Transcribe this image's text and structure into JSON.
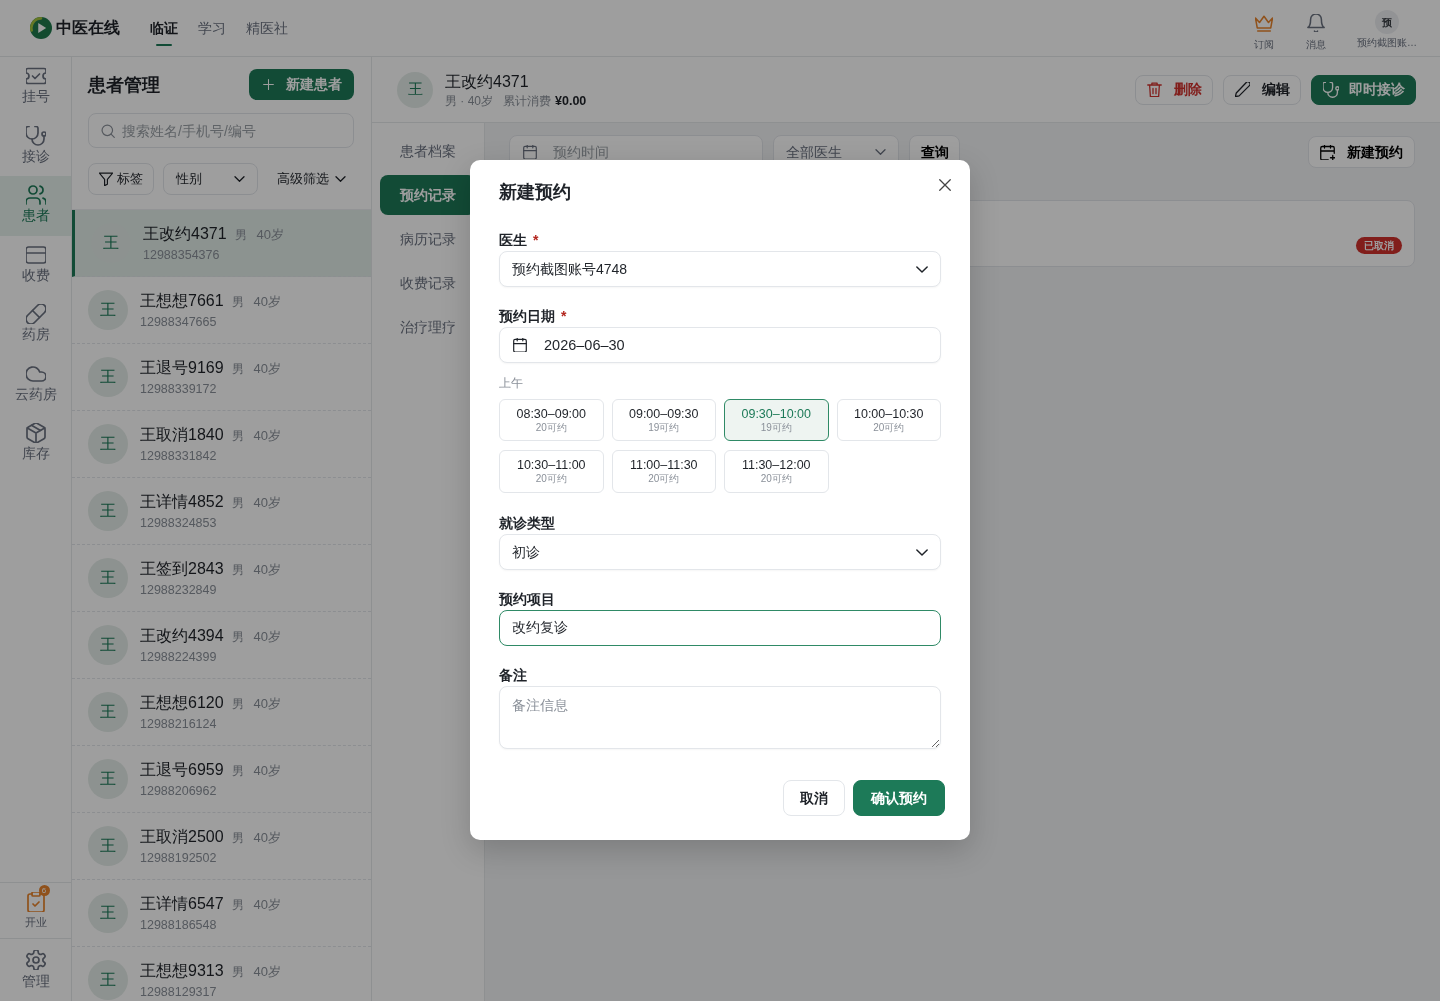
{
  "top_bar": {
    "brand": "中医在线",
    "nav": [
      {
        "label": "临证",
        "selected": true
      },
      {
        "label": "学习",
        "selected": false
      },
      {
        "label": "精医社",
        "selected": false
      }
    ],
    "actions": [
      {
        "label": "订阅"
      },
      {
        "label": "消息"
      }
    ],
    "user": {
      "avatar": "预",
      "name": "预约截图账…"
    }
  },
  "rail": {
    "items": [
      {
        "label": "挂号",
        "selected": false
      },
      {
        "label": "接诊",
        "selected": false
      },
      {
        "label": "患者",
        "selected": true
      },
      {
        "label": "收费",
        "selected": false
      },
      {
        "label": "药房",
        "selected": false
      },
      {
        "label": "云药房",
        "selected": false
      },
      {
        "label": "库存",
        "selected": false
      }
    ],
    "bottom": [
      {
        "label": "开业",
        "badge": "6"
      },
      {
        "label": "管理"
      }
    ]
  },
  "patients": {
    "title": "患者管理",
    "new_button": "新建患者",
    "search": {
      "placeholder": "搜索姓名/手机号/编号"
    },
    "filters": {
      "tag": "标签",
      "gender": "性别",
      "advanced": "高级筛选"
    },
    "items": [
      {
        "avatar": "王",
        "name": "王改约4371",
        "gender": "男",
        "age": "40岁",
        "phone": "12988354376",
        "selected": true
      },
      {
        "avatar": "王",
        "name": "王想想7661",
        "gender": "男",
        "age": "40岁",
        "phone": "12988347665",
        "selected": false
      },
      {
        "avatar": "王",
        "name": "王退号9169",
        "gender": "男",
        "age": "40岁",
        "phone": "12988339172",
        "selected": false
      },
      {
        "avatar": "王",
        "name": "王取消1840",
        "gender": "男",
        "age": "40岁",
        "phone": "12988331842",
        "selected": false
      },
      {
        "avatar": "王",
        "name": "王详情4852",
        "gender": "男",
        "age": "40岁",
        "phone": "12988324853",
        "selected": false
      },
      {
        "avatar": "王",
        "name": "王签到2843",
        "gender": "男",
        "age": "40岁",
        "phone": "12988232849",
        "selected": false
      },
      {
        "avatar": "王",
        "name": "王改约4394",
        "gender": "男",
        "age": "40岁",
        "phone": "12988224399",
        "selected": false
      },
      {
        "avatar": "王",
        "name": "王想想6120",
        "gender": "男",
        "age": "40岁",
        "phone": "12988216124",
        "selected": false
      },
      {
        "avatar": "王",
        "name": "王退号6959",
        "gender": "男",
        "age": "40岁",
        "phone": "12988206962",
        "selected": false
      },
      {
        "avatar": "王",
        "name": "王取消2500",
        "gender": "男",
        "age": "40岁",
        "phone": "12988192502",
        "selected": false
      },
      {
        "avatar": "王",
        "name": "王详情6547",
        "gender": "男",
        "age": "40岁",
        "phone": "12988186548",
        "selected": false
      },
      {
        "avatar": "王",
        "name": "王想想9313",
        "gender": "男",
        "age": "40岁",
        "phone": "12988129317",
        "selected": false
      }
    ]
  },
  "detail": {
    "patient": {
      "avatar": "王",
      "name": "王改约4371",
      "info": "男 · 40岁",
      "spend_label": "累计消费",
      "spend": "¥0.00"
    },
    "actions": [
      {
        "label": "删除",
        "kind": "danger"
      },
      {
        "label": "编辑",
        "kind": "outline"
      },
      {
        "label": "即时接诊",
        "kind": "primary"
      }
    ],
    "tabs": [
      {
        "label": "患者档案",
        "selected": false
      },
      {
        "label": "预约记录",
        "selected": true
      },
      {
        "label": "病历记录",
        "selected": false
      },
      {
        "label": "收费记录",
        "selected": false
      },
      {
        "label": "治疗理疗",
        "selected": false
      }
    ],
    "filters": {
      "date_placeholder": "预约时间",
      "doctor": "全部医生",
      "query": "查询"
    },
    "new_button": "新建预约",
    "records": [
      {
        "status": "已取消",
        "kind": "cancelled"
      }
    ]
  },
  "modal": {
    "title": "新建预约",
    "fields": [
      {
        "kind": "select",
        "label": "医生",
        "required_mark": "*",
        "value": "预约截图账号4748",
        "focused": false
      },
      {
        "kind": "date",
        "label": "预约日期",
        "required_mark": "*",
        "value": "2026–06–30",
        "focused": false
      },
      {
        "kind": "slots",
        "period": "上午",
        "slots": [
          {
            "time": "08:30–09:00",
            "availability": "20可约",
            "selected": false
          },
          {
            "time": "09:00–09:30",
            "availability": "19可约",
            "selected": false
          },
          {
            "time": "09:30–10:00",
            "availability": "19可约",
            "selected": true
          },
          {
            "time": "10:00–10:30",
            "availability": "20可约",
            "selected": false
          },
          {
            "time": "10:30–11:00",
            "availability": "20可约",
            "selected": false
          },
          {
            "time": "11:00–11:30",
            "availability": "20可约",
            "selected": false
          },
          {
            "time": "11:30–12:00",
            "availability": "20可约",
            "selected": false
          }
        ]
      },
      {
        "kind": "select",
        "label": "就诊类型",
        "value": "初诊",
        "focused": false
      },
      {
        "kind": "text",
        "label": "预约项目",
        "value": "改约复诊",
        "focused": true
      },
      {
        "kind": "textarea",
        "label": "备注",
        "placeholder": "备注信息",
        "focused": false
      }
    ],
    "buttons": [
      {
        "label": "取消",
        "kind": "secondary"
      },
      {
        "label": "确认预约",
        "kind": "primary"
      }
    ]
  }
}
